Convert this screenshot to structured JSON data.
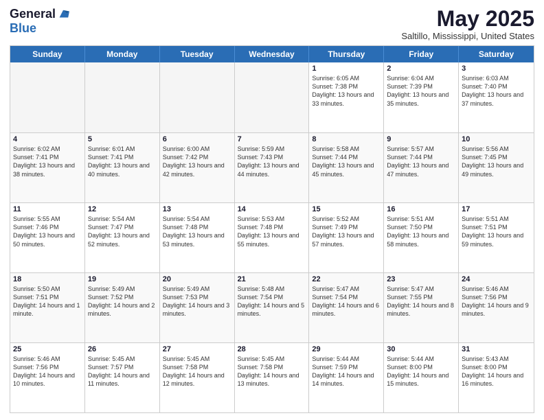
{
  "logo": {
    "general": "General",
    "blue": "Blue"
  },
  "header": {
    "month": "May 2025",
    "location": "Saltillo, Mississippi, United States"
  },
  "weekdays": [
    "Sunday",
    "Monday",
    "Tuesday",
    "Wednesday",
    "Thursday",
    "Friday",
    "Saturday"
  ],
  "weeks": [
    [
      {
        "day": "",
        "empty": true
      },
      {
        "day": "",
        "empty": true
      },
      {
        "day": "",
        "empty": true
      },
      {
        "day": "",
        "empty": true
      },
      {
        "day": "1",
        "sunrise": "6:05 AM",
        "sunset": "7:38 PM",
        "daylight": "13 hours and 33 minutes."
      },
      {
        "day": "2",
        "sunrise": "6:04 AM",
        "sunset": "7:39 PM",
        "daylight": "13 hours and 35 minutes."
      },
      {
        "day": "3",
        "sunrise": "6:03 AM",
        "sunset": "7:40 PM",
        "daylight": "13 hours and 37 minutes."
      }
    ],
    [
      {
        "day": "4",
        "sunrise": "6:02 AM",
        "sunset": "7:41 PM",
        "daylight": "13 hours and 38 minutes."
      },
      {
        "day": "5",
        "sunrise": "6:01 AM",
        "sunset": "7:41 PM",
        "daylight": "13 hours and 40 minutes."
      },
      {
        "day": "6",
        "sunrise": "6:00 AM",
        "sunset": "7:42 PM",
        "daylight": "13 hours and 42 minutes."
      },
      {
        "day": "7",
        "sunrise": "5:59 AM",
        "sunset": "7:43 PM",
        "daylight": "13 hours and 44 minutes."
      },
      {
        "day": "8",
        "sunrise": "5:58 AM",
        "sunset": "7:44 PM",
        "daylight": "13 hours and 45 minutes."
      },
      {
        "day": "9",
        "sunrise": "5:57 AM",
        "sunset": "7:44 PM",
        "daylight": "13 hours and 47 minutes."
      },
      {
        "day": "10",
        "sunrise": "5:56 AM",
        "sunset": "7:45 PM",
        "daylight": "13 hours and 49 minutes."
      }
    ],
    [
      {
        "day": "11",
        "sunrise": "5:55 AM",
        "sunset": "7:46 PM",
        "daylight": "13 hours and 50 minutes."
      },
      {
        "day": "12",
        "sunrise": "5:54 AM",
        "sunset": "7:47 PM",
        "daylight": "13 hours and 52 minutes."
      },
      {
        "day": "13",
        "sunrise": "5:54 AM",
        "sunset": "7:48 PM",
        "daylight": "13 hours and 53 minutes."
      },
      {
        "day": "14",
        "sunrise": "5:53 AM",
        "sunset": "7:48 PM",
        "daylight": "13 hours and 55 minutes."
      },
      {
        "day": "15",
        "sunrise": "5:52 AM",
        "sunset": "7:49 PM",
        "daylight": "13 hours and 57 minutes."
      },
      {
        "day": "16",
        "sunrise": "5:51 AM",
        "sunset": "7:50 PM",
        "daylight": "13 hours and 58 minutes."
      },
      {
        "day": "17",
        "sunrise": "5:51 AM",
        "sunset": "7:51 PM",
        "daylight": "13 hours and 59 minutes."
      }
    ],
    [
      {
        "day": "18",
        "sunrise": "5:50 AM",
        "sunset": "7:51 PM",
        "daylight": "14 hours and 1 minute."
      },
      {
        "day": "19",
        "sunrise": "5:49 AM",
        "sunset": "7:52 PM",
        "daylight": "14 hours and 2 minutes."
      },
      {
        "day": "20",
        "sunrise": "5:49 AM",
        "sunset": "7:53 PM",
        "daylight": "14 hours and 3 minutes."
      },
      {
        "day": "21",
        "sunrise": "5:48 AM",
        "sunset": "7:54 PM",
        "daylight": "14 hours and 5 minutes."
      },
      {
        "day": "22",
        "sunrise": "5:47 AM",
        "sunset": "7:54 PM",
        "daylight": "14 hours and 6 minutes."
      },
      {
        "day": "23",
        "sunrise": "5:47 AM",
        "sunset": "7:55 PM",
        "daylight": "14 hours and 8 minutes."
      },
      {
        "day": "24",
        "sunrise": "5:46 AM",
        "sunset": "7:56 PM",
        "daylight": "14 hours and 9 minutes."
      }
    ],
    [
      {
        "day": "25",
        "sunrise": "5:46 AM",
        "sunset": "7:56 PM",
        "daylight": "14 hours and 10 minutes."
      },
      {
        "day": "26",
        "sunrise": "5:45 AM",
        "sunset": "7:57 PM",
        "daylight": "14 hours and 11 minutes."
      },
      {
        "day": "27",
        "sunrise": "5:45 AM",
        "sunset": "7:58 PM",
        "daylight": "14 hours and 12 minutes."
      },
      {
        "day": "28",
        "sunrise": "5:45 AM",
        "sunset": "7:58 PM",
        "daylight": "14 hours and 13 minutes."
      },
      {
        "day": "29",
        "sunrise": "5:44 AM",
        "sunset": "7:59 PM",
        "daylight": "14 hours and 14 minutes."
      },
      {
        "day": "30",
        "sunrise": "5:44 AM",
        "sunset": "8:00 PM",
        "daylight": "14 hours and 15 minutes."
      },
      {
        "day": "31",
        "sunrise": "5:43 AM",
        "sunset": "8:00 PM",
        "daylight": "14 hours and 16 minutes."
      }
    ]
  ]
}
